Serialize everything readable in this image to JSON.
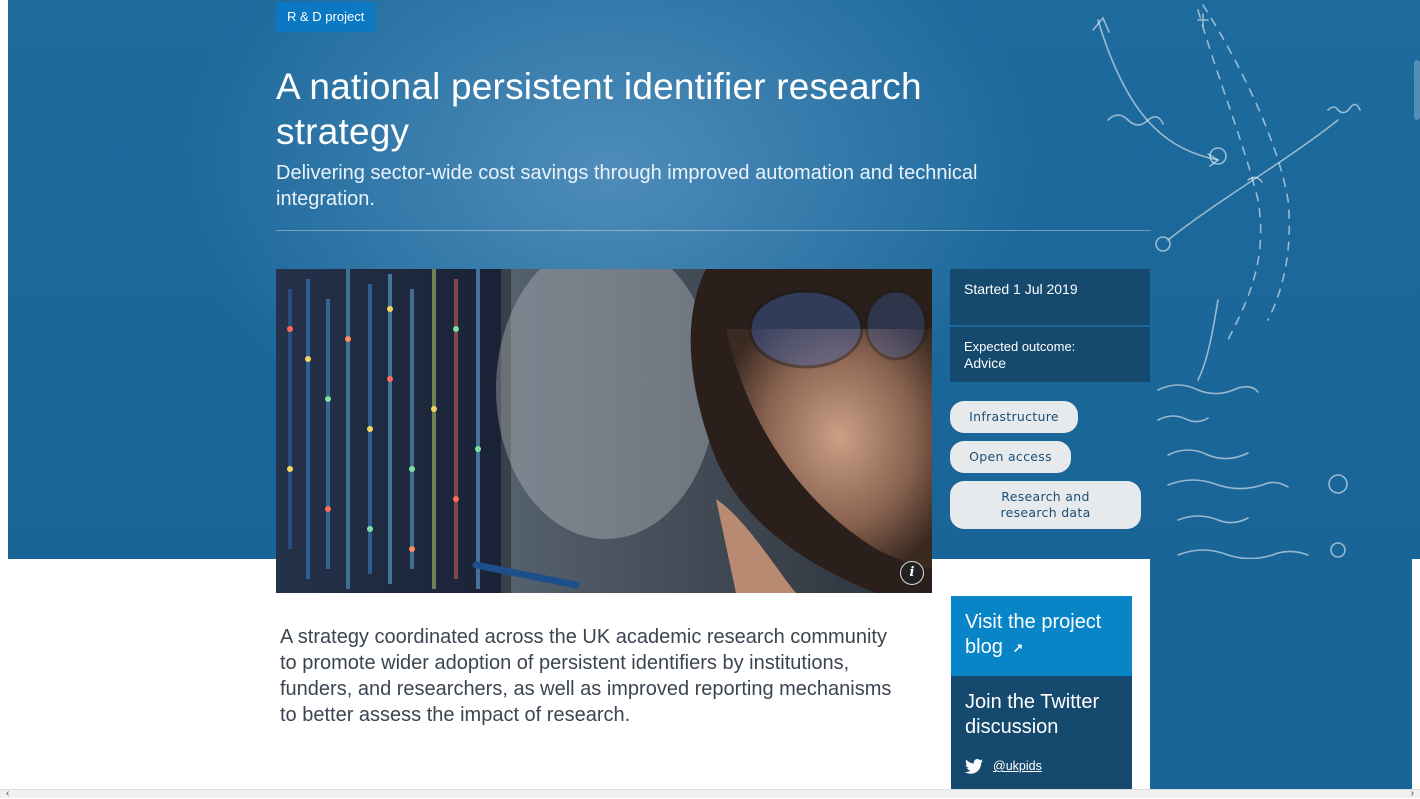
{
  "header": {
    "badge": "R & D project",
    "title": "A national persistent identifier research strategy",
    "subtitle": "Delivering sector-wide cost savings through improved automation and technical integration."
  },
  "meta": {
    "started": "Started 1 Jul 2019",
    "outcome_label": "Expected outcome:",
    "outcome_value": "Advice"
  },
  "tags": [
    "Infrastructure",
    "Open access",
    "Research and research data"
  ],
  "cards": {
    "blog_label": "Visit the project blog",
    "blog_arrow": "↗",
    "twitter_label": "Join the Twitter discussion",
    "twitter_handle": "@ukpids"
  },
  "body": {
    "lead": "A strategy coordinated across the UK academic research community to promote wider adoption of persistent identifiers by institutions, funders, and researchers, as well as improved reporting mechanisms to better assess the impact of research."
  },
  "icons": {
    "info": "info-icon",
    "twitter": "twitter-bird-icon",
    "external": "external-link-icon"
  },
  "colors": {
    "hero": "#1a6597",
    "badge": "#0a78c2",
    "meta": "#15496e",
    "blog": "#0785c7",
    "tag": "#e6eaed"
  }
}
